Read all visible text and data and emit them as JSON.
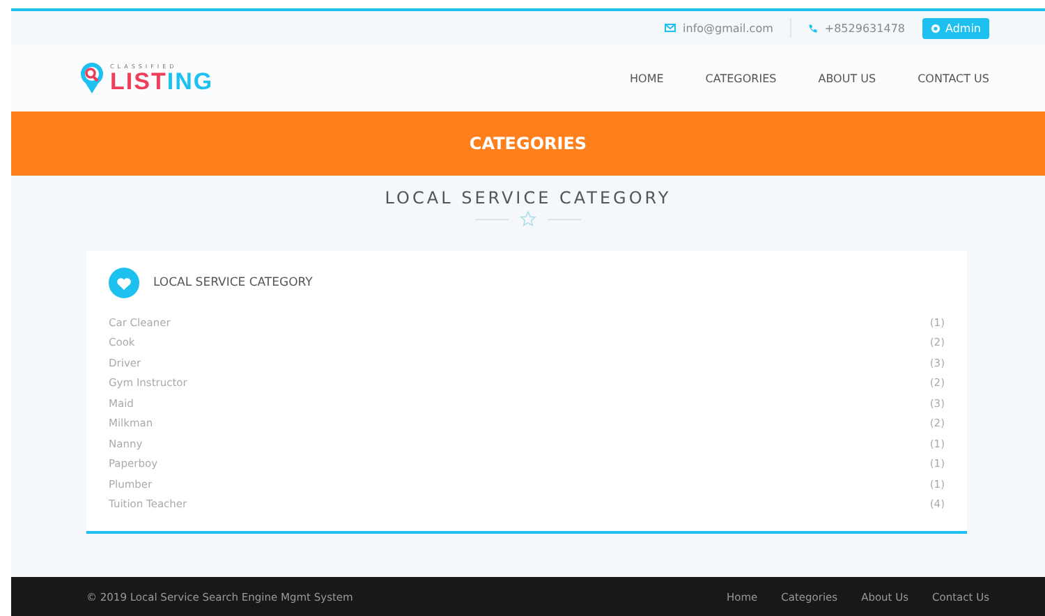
{
  "topbar": {
    "email": "info@gmail.com",
    "phone": "+8529631478",
    "admin_button": "Admin"
  },
  "logo": {
    "small": "CLASSIFIED",
    "big_1": "LIST",
    "big_2": "ING"
  },
  "nav": [
    {
      "label": "HOME"
    },
    {
      "label": "CATEGORIES"
    },
    {
      "label": "ABOUT US"
    },
    {
      "label": "CONTACT US"
    }
  ],
  "banner": {
    "title": "CATEGORIES"
  },
  "section": {
    "title": "LOCAL SERVICE CATEGORY"
  },
  "card": {
    "title": "LOCAL SERVICE CATEGORY",
    "items": [
      {
        "name": "Car Cleaner",
        "count": "(1)"
      },
      {
        "name": "Cook",
        "count": "(2)"
      },
      {
        "name": "Driver",
        "count": "(3)"
      },
      {
        "name": "Gym Instructor",
        "count": "(2)"
      },
      {
        "name": "Maid",
        "count": "(3)"
      },
      {
        "name": "Milkman",
        "count": "(2)"
      },
      {
        "name": "Nanny",
        "count": "(1)"
      },
      {
        "name": "Paperboy",
        "count": "(1)"
      },
      {
        "name": "Plumber",
        "count": "(1)"
      },
      {
        "name": "Tuition Teacher",
        "count": "(4)"
      }
    ]
  },
  "footer": {
    "copyright": "© 2019 Local Service Search Engine Mgmt System",
    "links": [
      {
        "label": "Home"
      },
      {
        "label": "Categories"
      },
      {
        "label": "About Us"
      },
      {
        "label": "Contact Us"
      }
    ]
  }
}
